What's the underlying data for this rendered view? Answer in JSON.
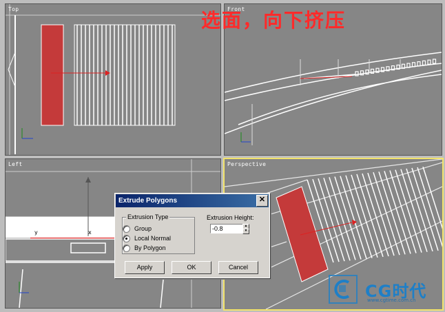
{
  "overlay_text": "选面，向下挤压",
  "viewports": {
    "top": {
      "label": "Top"
    },
    "front": {
      "label": "Front"
    },
    "left": {
      "label": "Left"
    },
    "perspective": {
      "label": "Perspective"
    }
  },
  "left_viewport_marks": {
    "y": "y",
    "x": "x"
  },
  "dialog": {
    "title": "Extrude Polygons",
    "close_glyph": "✕",
    "extrusion_type_label": "Extrusion Type",
    "options": [
      "Group",
      "Local Normal",
      "By Polygon"
    ],
    "selected_option": "Local Normal",
    "extrusion_height_label": "Extrusion Height:",
    "extrusion_height_value": "-0.8",
    "buttons": {
      "apply": "Apply",
      "ok": "OK",
      "cancel": "Cancel"
    }
  },
  "watermark": {
    "name": "CG时代",
    "url": "www.cgtime.com.cn"
  },
  "colors": {
    "overlay_red": "#ff2a2a",
    "selection_red": "#c43a3a",
    "active_border": "#f3e46a",
    "viewport_bg": "#868686"
  },
  "icons": [
    "close-icon",
    "spinner-up-icon",
    "spinner-down-icon",
    "cg-logo-icon"
  ]
}
